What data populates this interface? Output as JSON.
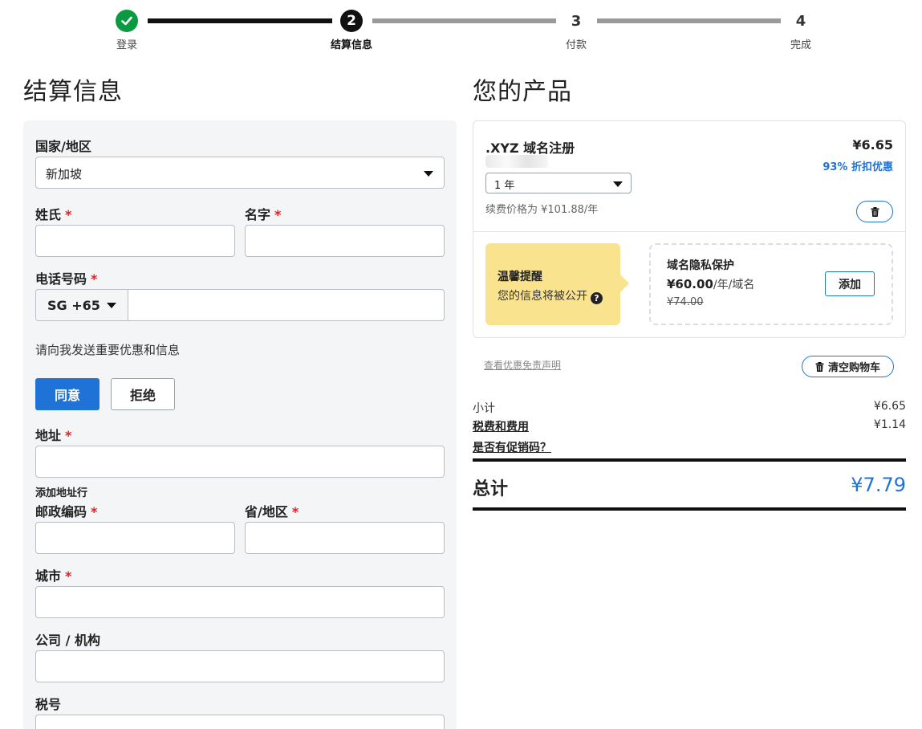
{
  "stepper": {
    "steps": [
      {
        "number": "",
        "label": "登录",
        "state": "done",
        "icon": "check-icon"
      },
      {
        "number": "2",
        "label": "结算信息",
        "state": "current"
      },
      {
        "number": "3",
        "label": "付款",
        "state": "todo"
      },
      {
        "number": "4",
        "label": "完成",
        "state": "todo"
      }
    ]
  },
  "billing": {
    "title": "结算信息",
    "country_label": "国家/地区",
    "country_value": "新加坡",
    "last_name_label": "姓氏",
    "first_name_label": "名字",
    "phone_label": "电话号码",
    "phone_prefix": "SG +65",
    "marketing_text": "请向我发送重要优惠和信息",
    "agree_label": "同意",
    "reject_label": "拒绝",
    "address_label": "地址",
    "add_address_line": "添加地址行",
    "postal_label": "邮政编码",
    "province_label": "省/地区",
    "city_label": "城市",
    "company_label": "公司 / 机构",
    "tax_label": "税号",
    "required_mark": "*"
  },
  "products": {
    "title": "您的产品",
    "item": {
      "name": ".XYZ 域名注册",
      "price": "¥6.65",
      "discount": "93% 折扣优惠",
      "term": "1 年",
      "renewal": "续费价格为 ¥101.88/年",
      "delete_icon": "trash-icon"
    },
    "tip": {
      "title": "温馨提醒",
      "text": "您的信息将被公开",
      "help_icon": "?"
    },
    "privacy": {
      "title": "域名隐私保护",
      "price": "¥60.00",
      "unit": "/年/域名",
      "old_price": "¥74.00",
      "add_label": "添加"
    }
  },
  "summary": {
    "disclaimer": "查看优惠免责声明",
    "clear_cart": "清空购物车",
    "subtotal_label": "小计",
    "subtotal_value": "¥6.65",
    "tax_label": "税费和费用",
    "tax_value": "¥1.14",
    "promo_label": "是否有促销码？",
    "total_label": "总计",
    "total_value": "¥7.79"
  },
  "colors": {
    "accent": "#1f73d6",
    "success": "#0a9a3f",
    "tip_bg": "#fae38f",
    "required": "#d22222"
  }
}
